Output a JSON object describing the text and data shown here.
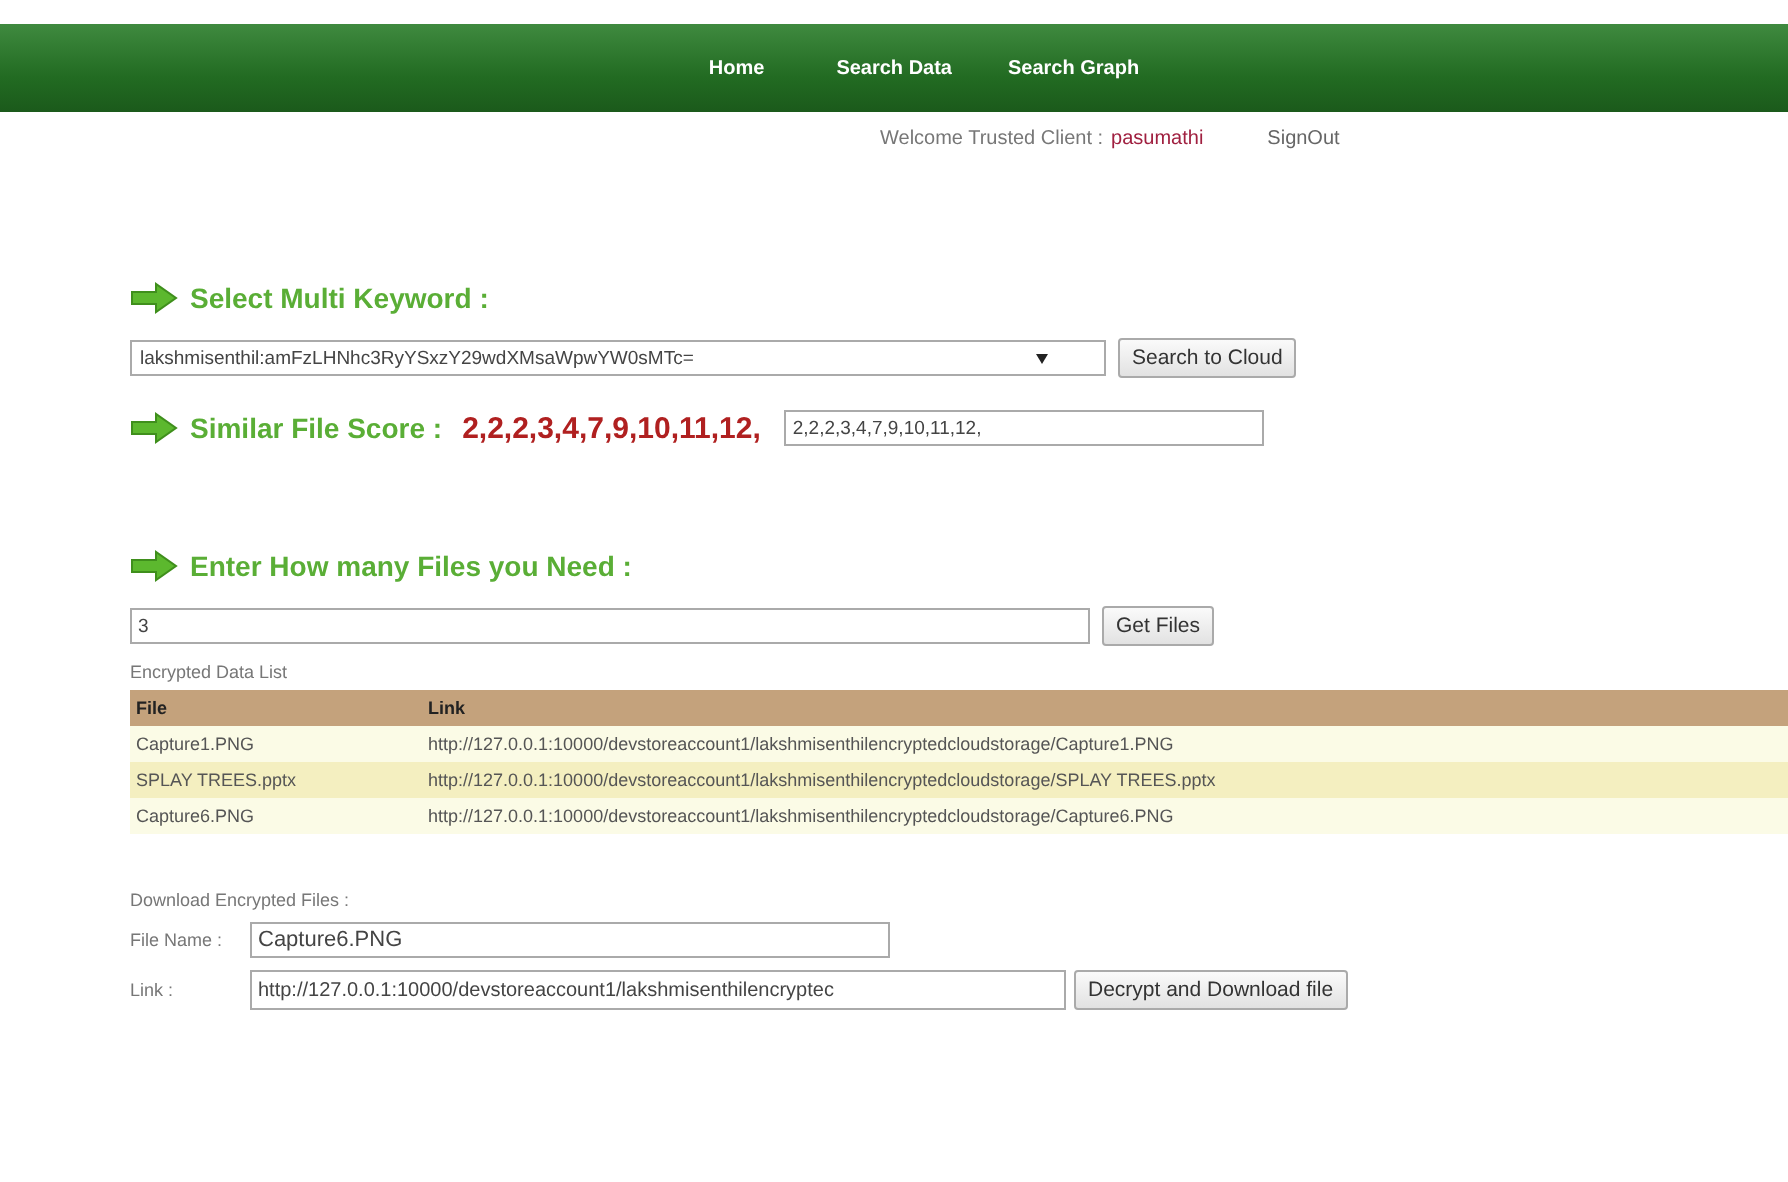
{
  "nav": {
    "items": [
      {
        "label": "Home"
      },
      {
        "label": "Search Data"
      },
      {
        "label": "Search Graph"
      }
    ]
  },
  "welcome": {
    "text": "Welcome Trusted Client :",
    "user": "pasumathi",
    "signout": "SignOut"
  },
  "keyword_section": {
    "heading": "Select Multi Keyword :",
    "select_value": "lakshmisenthil:amFzLHNhc3RyYSxzY29wdXMsaWpwYW0sMTc=",
    "button": "Search to Cloud"
  },
  "score_section": {
    "heading": "Similar File Score :",
    "score": "2,2,2,3,4,7,9,10,11,12,",
    "field_value": "2,2,2,3,4,7,9,10,11,12,"
  },
  "files_section": {
    "heading": "Enter How many Files you Need :",
    "field_value": "3",
    "button": "Get Files"
  },
  "table": {
    "caption": "Encrypted Data List",
    "columns": [
      "File",
      "Link"
    ],
    "rows": [
      [
        "Capture1.PNG",
        "http://127.0.0.1:10000/devstoreaccount1/lakshmisenthilencryptedcloudstorage/Capture1.PNG"
      ],
      [
        "SPLAY TREES.pptx",
        "http://127.0.0.1:10000/devstoreaccount1/lakshmisenthilencryptedcloudstorage/SPLAY TREES.pptx"
      ],
      [
        "Capture6.PNG",
        "http://127.0.0.1:10000/devstoreaccount1/lakshmisenthilencryptedcloudstorage/Capture6.PNG"
      ]
    ]
  },
  "download": {
    "caption": "Download Encrypted Files :",
    "file_label": "File Name :",
    "file_value": "Capture6.PNG",
    "link_label": "Link :",
    "link_value": "http://127.0.0.1:10000/devstoreaccount1/lakshmisenthilencryptec",
    "button": "Decrypt and Download file"
  }
}
